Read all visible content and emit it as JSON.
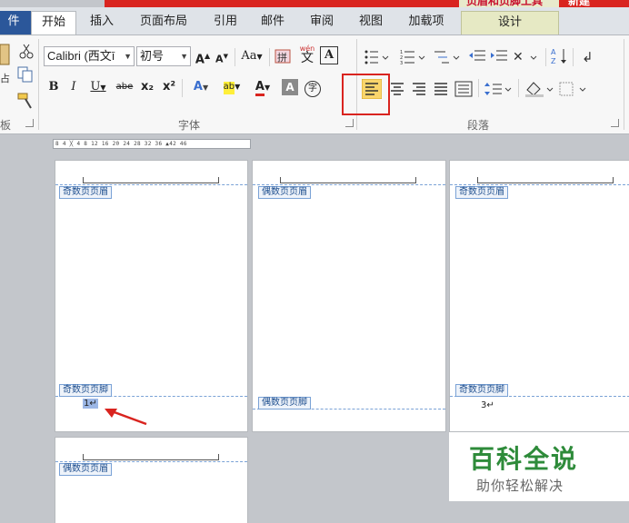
{
  "ribbon_context": {
    "tool_title": "页眉和页脚工具",
    "right_tab": "新建"
  },
  "tabs": [
    {
      "label": "件"
    },
    {
      "label": "开始"
    },
    {
      "label": "插入"
    },
    {
      "label": "页面布局"
    },
    {
      "label": "引用"
    },
    {
      "label": "邮件"
    },
    {
      "label": "审阅"
    },
    {
      "label": "视图"
    },
    {
      "label": "加载项"
    },
    {
      "label": "设计"
    }
  ],
  "clipboard": {
    "group_label": "板"
  },
  "font": {
    "font_name": "Calibri (西文ī",
    "font_size": "初号",
    "grow": "A",
    "shrink": "A",
    "case_change": "Aa",
    "phonetic": "拼",
    "pinyin_guide": "wén",
    "char_border": "A",
    "bold": "B",
    "italic": "I",
    "underline": "U",
    "strikethrough": "abe",
    "subscript": "x₂",
    "superscript": "x²",
    "text_effect": "A",
    "highlight": "ab",
    "font_color": "A",
    "char_shading": "A",
    "enclose": "字",
    "group_label": "字体"
  },
  "paragraph": {
    "group_label": "段落",
    "sort": "↓"
  },
  "ruler_text": "8 4 ╳ 4 8 12 16 20 24 28 32 36 ▲42 46",
  "pages": [
    {
      "header_tag": "奇数页页眉",
      "footer_tag": "奇数页页脚",
      "page_num": "1↵"
    },
    {
      "header_tag": "偶数页页眉",
      "footer_tag": "偶数页页脚",
      "page_num": ""
    },
    {
      "header_tag": "奇数页页眉",
      "footer_tag": "奇数页页脚",
      "page_num": "3↵"
    },
    {
      "header_tag": "偶数页页眉"
    }
  ],
  "watermark": {
    "title": "百科全说",
    "subtitle": "助你轻松解决"
  },
  "colors": {
    "accent": "#2b579a",
    "highlight_box": "#d9241f",
    "watermark": "#2e8b3a"
  }
}
